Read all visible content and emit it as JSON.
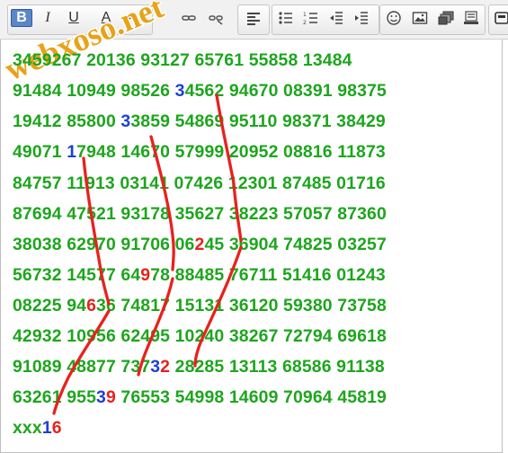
{
  "toolbar": {
    "buttons": [
      {
        "name": "bold-button",
        "glyph": "B"
      },
      {
        "name": "italic-button",
        "glyph": "I"
      },
      {
        "name": "underline-button",
        "glyph": "U"
      },
      {
        "name": "font-color-button",
        "glyph": "A"
      },
      {
        "name": "font-size-button",
        "glyph": "A"
      }
    ],
    "icons": [
      "link-icon",
      "unlink-icon",
      "align-left-icon",
      "bulleted-list-icon",
      "numbered-list-icon",
      "outdent-icon",
      "indent-icon",
      "smiley-icon",
      "image-icon",
      "gallery-icon",
      "special-char-icon",
      "source-icon"
    ]
  },
  "watermark": {
    "text": "webxoso.net",
    "color": "#e8a21a"
  },
  "colors": {
    "number_text": "#1ea51e",
    "highlight_blue": "#1d3fd6",
    "highlight_red": "#e8211d",
    "stroke": "#e8211d"
  },
  "editor": {
    "lines": [
      [
        "34",
        "59267 20136 93127 65761 55858 13484"
      ],
      [
        "91484 10949 98526 ",
        "3",
        "4562 94670 08391 98375"
      ],
      [
        "19412 85800 ",
        "3",
        "3859 54869 95110 98371 38429"
      ],
      [
        "49071 ",
        "1",
        "7948 14670 57999 20952 08816 11873"
      ],
      [
        "84757 11913 03141 07426 12301 87485 01716"
      ],
      [
        "87694 47521 93178 35627 38223 57057 87360"
      ],
      [
        "38038 62970 91706 06",
        "2",
        "45 36904 74825 03257"
      ],
      [
        "56732 14577 64",
        "9",
        "78 88485 76711 51416 01243"
      ],
      [
        "08225 94",
        "6",
        "36 74817 15131 36120 59380 73758"
      ],
      [
        "42932 10956 62495 10240 38267 72794 69618"
      ],
      [
        "91089 48877 737",
        "3",
        "2",
        " 28285 13113 68586 91138"
      ],
      [
        "63261 955",
        "3",
        "9",
        " 76553 54998 14609 70964 45819"
      ],
      [
        "xxx",
        "1",
        "6"
      ]
    ]
  }
}
